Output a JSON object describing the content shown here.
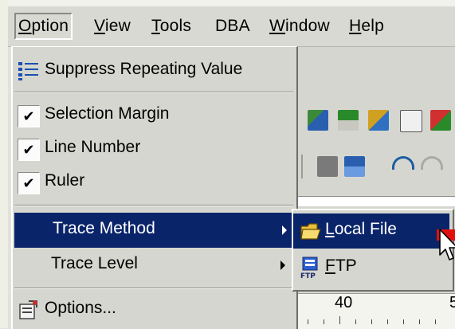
{
  "menubar": {
    "items": [
      {
        "label": "Option",
        "mnemonic": "O",
        "active": true
      },
      {
        "label": "View",
        "mnemonic": "V"
      },
      {
        "label": "Tools",
        "mnemonic": "T"
      },
      {
        "label": "DBA",
        "mnemonic": ""
      },
      {
        "label": "Window",
        "mnemonic": "W"
      },
      {
        "label": "Help",
        "mnemonic": "H"
      }
    ]
  },
  "option_menu": {
    "suppress": {
      "label": "Suppress Repeating Value",
      "icon": "list-icon"
    },
    "selection_margin": {
      "label": "Selection Margin",
      "checked": true
    },
    "line_number": {
      "label": "Line Number",
      "checked": true
    },
    "ruler": {
      "label": "Ruler",
      "checked": true
    },
    "trace_method": {
      "label": "Trace Method",
      "highlighted": true
    },
    "trace_level": {
      "label": "Trace Level"
    },
    "options": {
      "label": "Options...",
      "icon": "options-icon"
    }
  },
  "check_glyph": "✔",
  "trace_submenu": {
    "local_file": {
      "label": "Local File",
      "mnemonic": "L",
      "icon": "open-folder-icon",
      "highlighted": true
    },
    "ftp": {
      "label": "FTP",
      "mnemonic": "F",
      "icon": "ftp-icon",
      "icon_text": "FTP"
    }
  },
  "ruler": {
    "marks": [
      "40",
      "5"
    ]
  },
  "colors": {
    "highlight": "#0a246a",
    "menu_bg": "#d6d6d0",
    "red_marker": "#e01010"
  }
}
